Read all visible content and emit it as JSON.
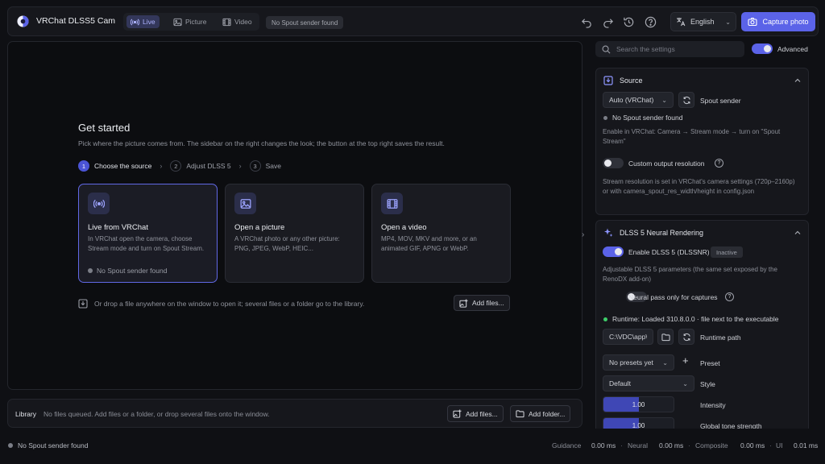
{
  "app": {
    "title": "VRChat DLSS5 Cam"
  },
  "modes": [
    {
      "label": "Live",
      "active": true
    },
    {
      "label": "Picture",
      "active": false
    },
    {
      "label": "Video",
      "active": false
    }
  ],
  "header_status": "No Spout sender found",
  "toolbar": {
    "language": "English",
    "capture_label": "Capture photo"
  },
  "get_started": {
    "title": "Get started",
    "subtitle": "Pick where the picture comes from. The sidebar on the right changes the look; the button at the top right saves the result.",
    "steps": [
      {
        "num": "1",
        "label": "Choose the source"
      },
      {
        "num": "2",
        "label": "Adjust DLSS 5"
      },
      {
        "num": "3",
        "label": "Save"
      }
    ],
    "cards": [
      {
        "title": "Live from VRChat",
        "desc": "In VRChat open the camera, choose Stream mode and turn on Spout Stream.",
        "status": "No Spout sender found"
      },
      {
        "title": "Open a picture",
        "desc": "A VRChat photo or any other picture: PNG, JPEG, WebP, HEIC..."
      },
      {
        "title": "Open a video",
        "desc": "MP4, MOV, MKV and more, or an animated GIF, APNG or WebP."
      }
    ],
    "drop_hint": "Or drop a file anywhere on the window to open it; several files or a folder go to the library.",
    "add_files": "Add files..."
  },
  "library": {
    "label": "Library",
    "empty": "No files queued. Add files or a folder, or drop several files onto the window.",
    "add_files": "Add files...",
    "add_folder": "Add folder..."
  },
  "statusbar": {
    "spout": "No Spout sender found",
    "metrics": [
      {
        "label": "Guidance",
        "value": "0.00 ms"
      },
      {
        "label": "Neural",
        "value": "0.00 ms"
      },
      {
        "label": "Composite",
        "value": "0.00 ms"
      },
      {
        "label": "UI",
        "value": "0.01 ms"
      }
    ]
  },
  "sidebar": {
    "search_placeholder": "Search the settings",
    "advanced_label": "Advanced",
    "source": {
      "title": "Source",
      "source_select": "Auto (VRChat)",
      "spout_sender": "Spout sender",
      "status": "No Spout sender found",
      "hint": "Enable in VRChat: Camera → Stream mode → turn on \"Spout Stream\"",
      "custom_res_label": "Custom output resolution",
      "res_note": "Stream resolution is set in VRChat's camera settings (720p–2160p) or with camera_spout_res_width/height in config.json"
    },
    "dlss": {
      "title": "DLSS 5 Neural Rendering",
      "enable_label": "Enable DLSS 5 (DLSSNR)",
      "badge": "Inactive",
      "desc": "Adjustable DLSS 5 parameters (the same set exposed by the RenoDX add-on)",
      "neural_pass_label": "Neural pass only for captures",
      "runtime": "Runtime: Loaded 310.8.0.0 · file next to the executable",
      "runtime_path_value": "C:\\VDC\\app\\n",
      "runtime_path_label": "Runtime path",
      "preset_select": "No presets yet",
      "preset_label": "Preset",
      "style_select": "Default",
      "style_label": "Style",
      "sliders": [
        {
          "label": "Intensity",
          "value": "1.00",
          "fraction": 0.5
        },
        {
          "label": "Global tone strength",
          "value": "1.00",
          "fraction": 0.5
        }
      ]
    }
  }
}
